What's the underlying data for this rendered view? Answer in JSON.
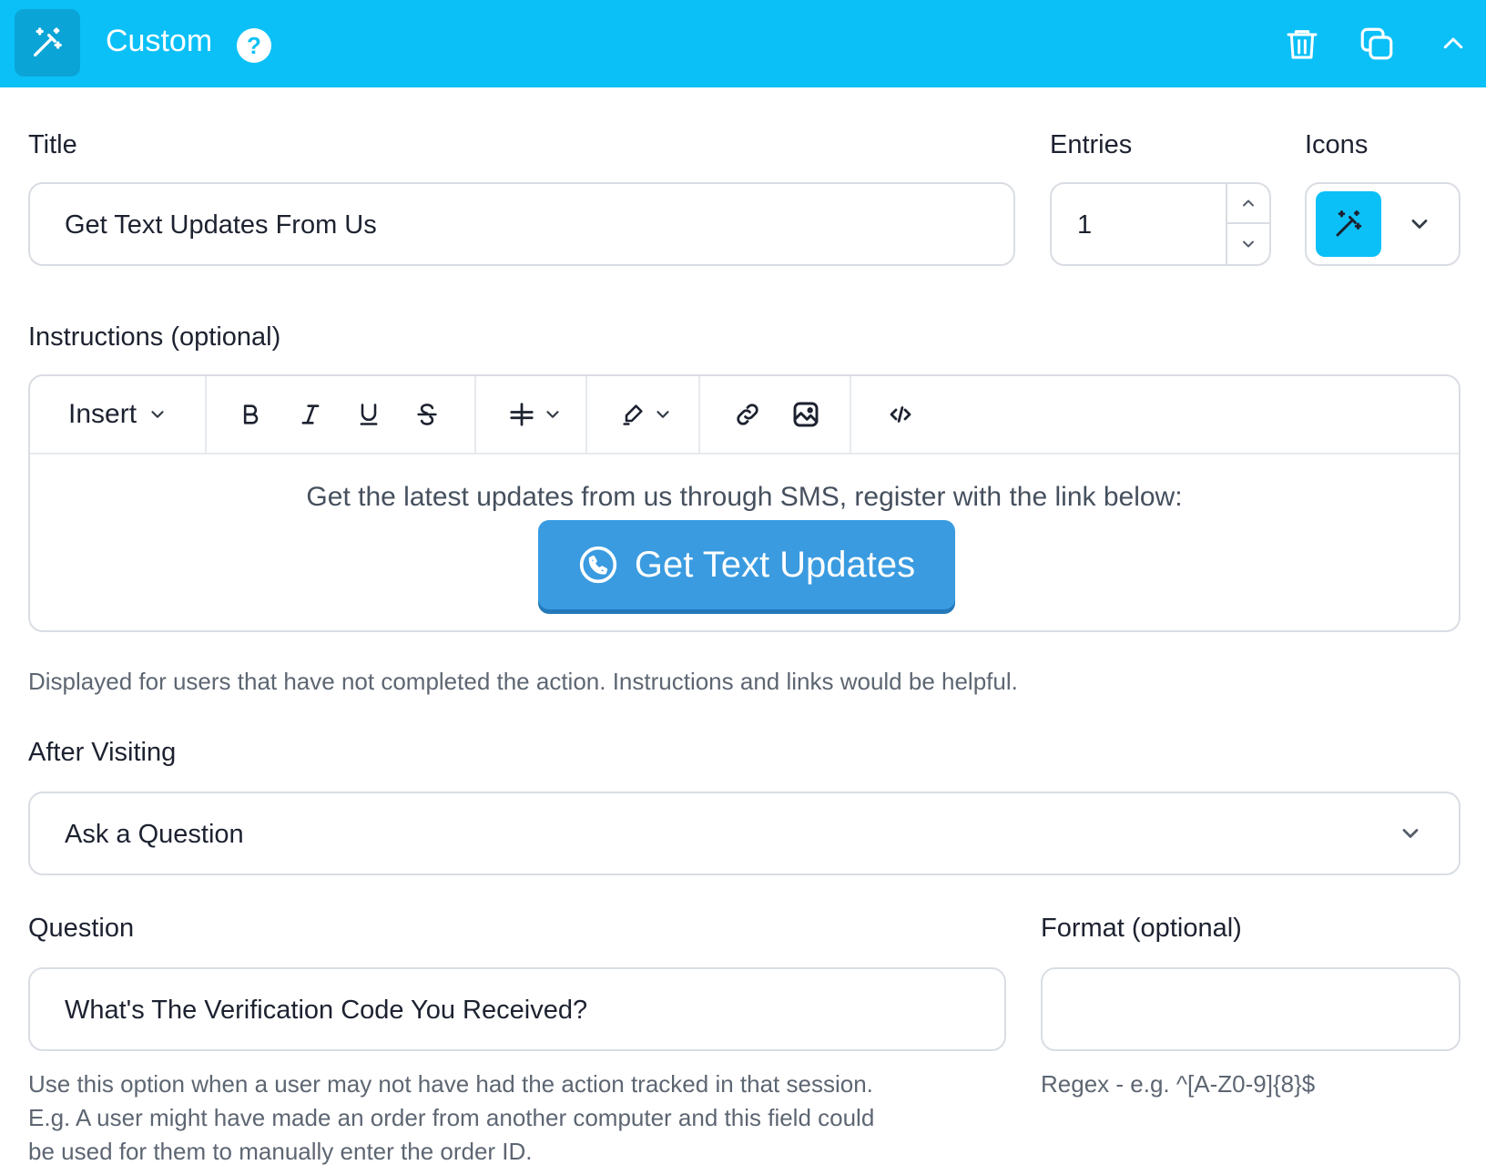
{
  "header": {
    "title": "Custom",
    "help": "?",
    "bg_color": "#0bc0f7",
    "icons": [
      "magic-wand-icon",
      "trash-icon",
      "copy-icon",
      "chevron-up-icon"
    ]
  },
  "title_field": {
    "label": "Title",
    "value": "Get Text Updates From Us"
  },
  "entries_field": {
    "label": "Entries",
    "value": "1"
  },
  "icons_field": {
    "label": "Icons",
    "selected_icon": "magic-wand-icon"
  },
  "instructions": {
    "label": "Instructions (optional)",
    "toolbar": {
      "insert_label": "Insert",
      "buttons": [
        "bold-icon",
        "italic-icon",
        "underline-icon",
        "strikethrough-icon",
        "align-icon",
        "highlighter-icon",
        "link-icon",
        "image-icon",
        "code-icon"
      ]
    },
    "body_text": "Get the latest updates from us through SMS, register with the link below:",
    "cta_label": "Get Text Updates",
    "cta_color": "#3a9be0",
    "help": "Displayed for users that have not completed the action. Instructions and links would be helpful."
  },
  "after_visiting": {
    "label": "After Visiting",
    "value": "Ask a Question"
  },
  "question": {
    "label": "Question",
    "value": "What's The Verification Code You Received?",
    "help_lines": [
      "Use this option when a user may not have had the action tracked in that session.",
      "E.g. A user might have made an order from another computer and this field could",
      "be used for them to manually enter the order ID."
    ]
  },
  "format": {
    "label": "Format (optional)",
    "value": "",
    "help": "Regex - e.g. ^[A-Z0-9]{8}$"
  }
}
